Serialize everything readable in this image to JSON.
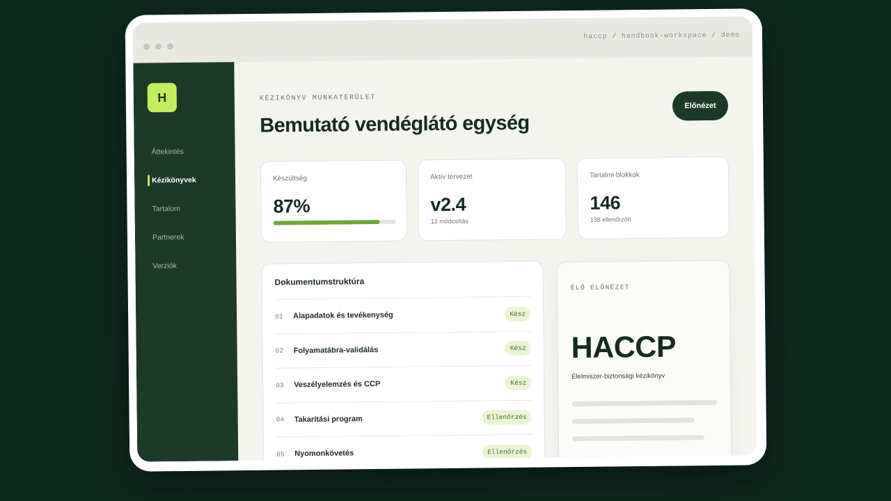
{
  "browser": {
    "breadcrumb": "haccp / handbook-workspace / demo"
  },
  "sidebar": {
    "logo_letter": "H",
    "items": [
      {
        "label": "Áttekintés",
        "active": false
      },
      {
        "label": "Kézikönyvek",
        "active": true
      },
      {
        "label": "Tartalom",
        "active": false
      },
      {
        "label": "Partnerek",
        "active": false
      },
      {
        "label": "Verziók",
        "active": false
      }
    ]
  },
  "header": {
    "kicker": "KÉZIKÖNYV MUNKATERÜLET",
    "title": "Bemutató vendéglátó egység",
    "preview_button": "Előnézet"
  },
  "stats": [
    {
      "label": "Készültség",
      "value": "87%",
      "progress": 0.87
    },
    {
      "label": "Aktív tervezet",
      "value": "v2.4",
      "sub": "12 módosítás"
    },
    {
      "label": "Tartalmi blokkok",
      "value": "146",
      "sub": "138 ellenőrzött"
    }
  ],
  "document_structure": {
    "title": "Dokumentumstruktúra",
    "rows": [
      {
        "num": "01",
        "label": "Alapadatok és tevékenység",
        "status": "Kész"
      },
      {
        "num": "02",
        "label": "Folyamatábra-validálás",
        "status": "Kész"
      },
      {
        "num": "03",
        "label": "Veszélyelemzés és CCP",
        "status": "Kész"
      },
      {
        "num": "04",
        "label": "Takarítási program",
        "status": "Ellenőrzés"
      },
      {
        "num": "05",
        "label": "Nyomonkövetés",
        "status": "Ellenőrzés"
      }
    ]
  },
  "live_preview": {
    "label": "ÉLŐ ELŐNÉZET",
    "title": "HACCP",
    "subtitle": "Élelmiszer-biztonsági kézikönyv"
  },
  "colors": {
    "background": "#0f2a1f",
    "sidebar": "#1d3a28",
    "accent": "#c2ee5e",
    "progress": "#6ea83b"
  }
}
